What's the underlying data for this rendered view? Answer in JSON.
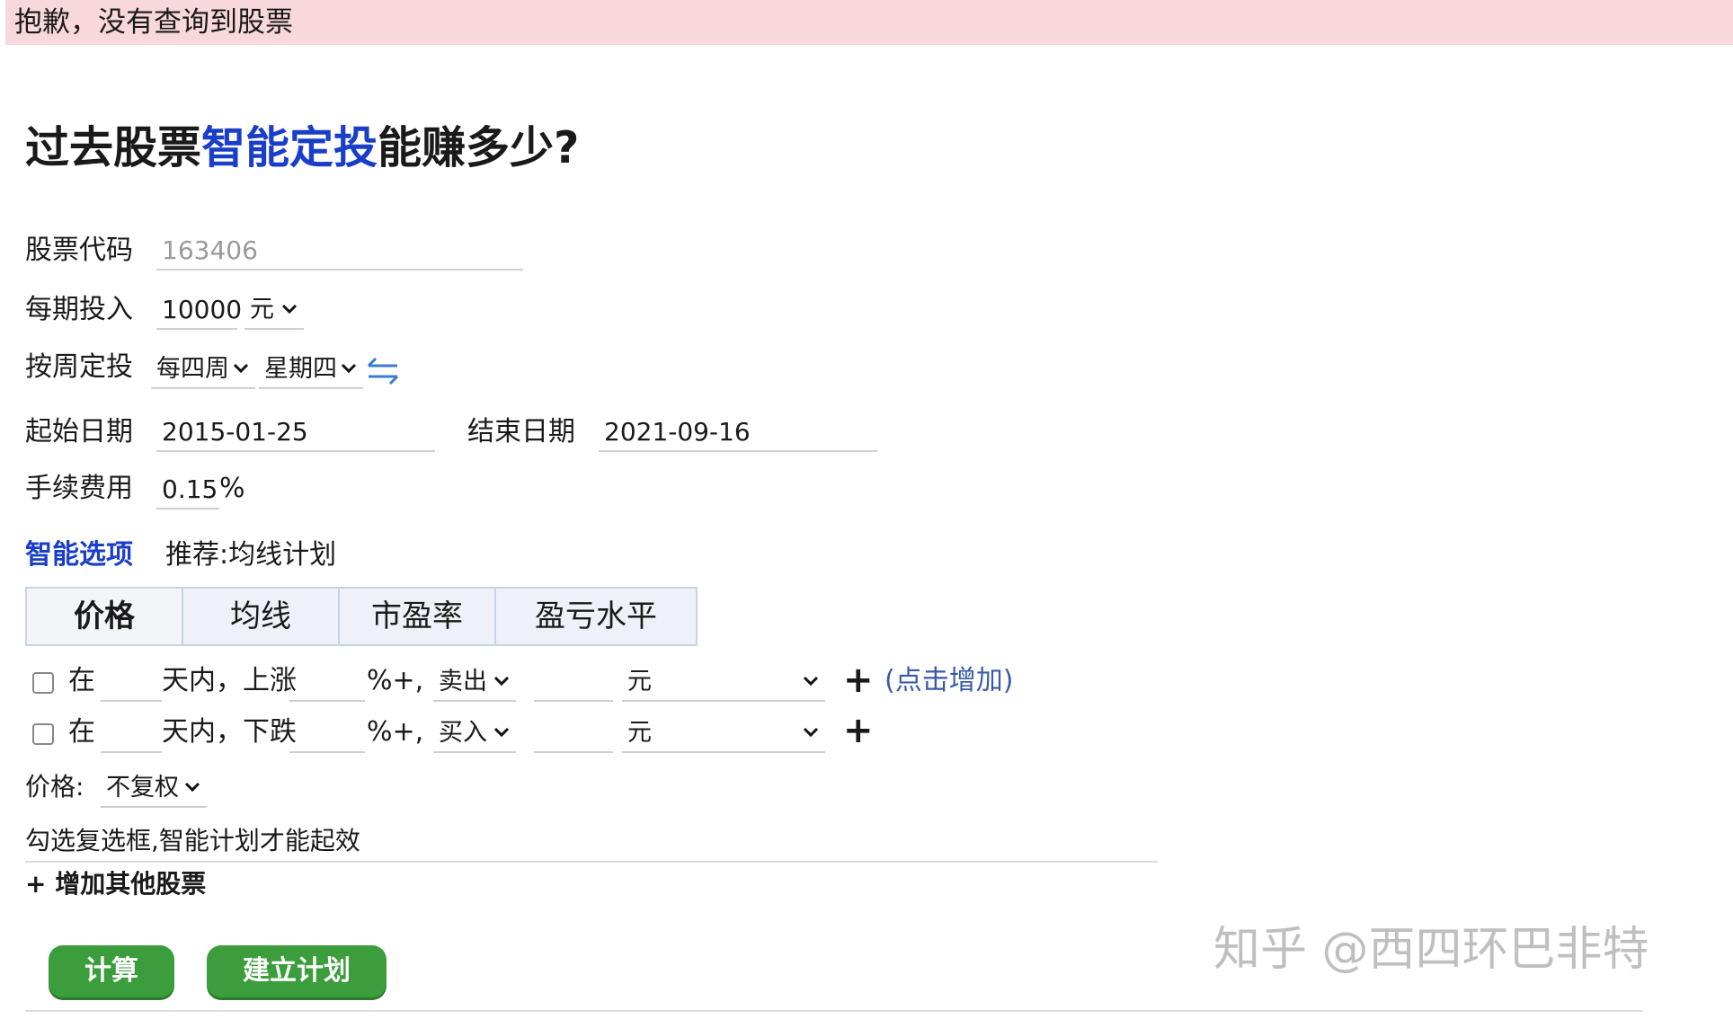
{
  "alert": {
    "text": "抱歉，没有查询到股票"
  },
  "title": {
    "prefix": "过去股票",
    "highlight": "智能定投",
    "suffix": "能赚多少?"
  },
  "form": {
    "code_label": "股票代码",
    "code_placeholder": "163406",
    "invest_label": "每期投入",
    "invest_value": "10000",
    "unit_value": "元",
    "period_label": "按周定投",
    "period_freq": "每四周",
    "period_day": "星期四",
    "start_label": "起始日期",
    "start_value": "2015-01-25",
    "end_label": "结束日期",
    "end_value": "2021-09-16",
    "fee_label": "手续费用",
    "fee_value": "0.15",
    "fee_unit": "%"
  },
  "smart": {
    "label": "智能选项",
    "recommend": "推荐:均线计划",
    "tabs": [
      "价格",
      "均线",
      "市盈率",
      "盈亏水平"
    ],
    "rows": [
      {
        "pre": "在",
        "mid": "天内，上涨",
        "pct": "%+,",
        "action": "卖出",
        "unit": "元",
        "extra": "(点击增加)"
      },
      {
        "pre": "在",
        "mid": "天内，下跌",
        "pct": "%+,",
        "action": "买入",
        "unit": "元"
      }
    ],
    "price_label": "价格:",
    "price_value": "不复权",
    "hint": "勾选复选框,智能计划才能起效",
    "add_stock": "+ 增加其他股票"
  },
  "buttons": {
    "calc": "计算",
    "plan": "建立计划"
  },
  "watermark": "知乎 @西四环巴非特",
  "colors": {
    "accent": "#1a3ec8",
    "alert_bg": "#f8d8dc",
    "button": "#3b9d3b"
  }
}
